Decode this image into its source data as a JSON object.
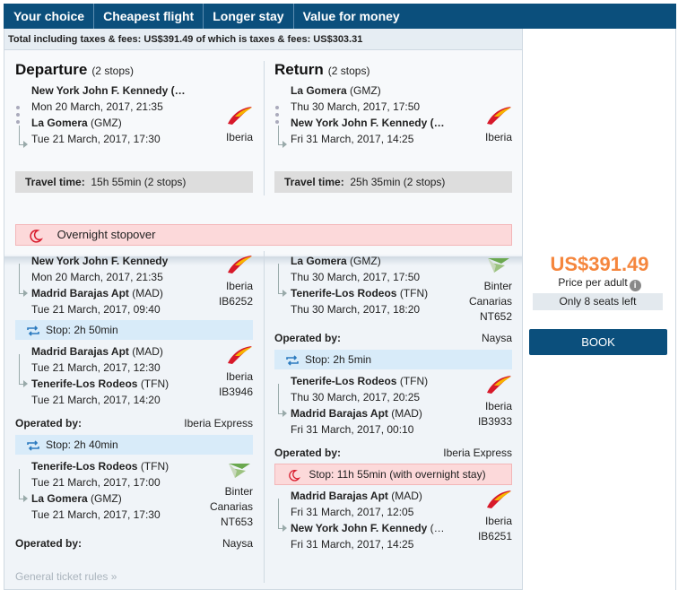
{
  "tabs": [
    "Your choice",
    "Cheapest flight",
    "Longer stay",
    "Value for money"
  ],
  "totals": "Total including taxes & fees: US$391.49 of which is taxes & fees: US$303.31",
  "summary": {
    "departure": {
      "title": "Departure",
      "stops": "(2 stops)",
      "from_city": "New York John F. Kennedy (…",
      "from_dt": "Mon 20 March, 2017, 21:35",
      "to_city": "La Gomera",
      "to_code": "(GMZ)",
      "to_dt": "Tue 21 March, 2017, 17:30",
      "airline": "Iberia",
      "travel_label": "Travel time:",
      "travel_value": "15h 55min (2 stops)"
    },
    "return": {
      "title": "Return",
      "stops": "(2 stops)",
      "from_city": "La Gomera",
      "from_code": "(GMZ)",
      "from_dt": "Thu 30 March, 2017, 17:50",
      "to_city": "New York John F. Kennedy (…",
      "to_dt": "Fri 31 March, 2017, 14:25",
      "airline": "Iberia",
      "travel_label": "Travel time:",
      "travel_value": "25h 35min (2 stops)"
    },
    "overnight": "Overnight stopover"
  },
  "details": {
    "left": {
      "seg1": {
        "from_city": "New York John F. Kennedy",
        "from_dt": "Mon 20 March, 2017, 21:35",
        "to_city": "Madrid Barajas Apt",
        "to_code": "(MAD)",
        "to_dt": "Tue 21 March, 2017, 09:40",
        "airline": "Iberia",
        "flight": "IB6252"
      },
      "stop1": "Stop: 2h 50min",
      "seg2": {
        "from_city": "Madrid Barajas Apt",
        "from_code": "(MAD)",
        "from_dt": "Tue 21 March, 2017, 12:30",
        "to_city": "Tenerife-Los Rodeos",
        "to_code": "(TFN)",
        "to_dt": "Tue 21 March, 2017, 14:20",
        "airline": "Iberia",
        "flight": "IB3946"
      },
      "op2_label": "Operated by:",
      "op2_name": "Iberia Express",
      "stop2": "Stop: 2h 40min",
      "seg3": {
        "from_city": "Tenerife-Los Rodeos",
        "from_code": "(TFN)",
        "from_dt": "Tue 21 March, 2017, 17:00",
        "to_city": "La Gomera",
        "to_code": "(GMZ)",
        "to_dt": "Tue 21 March, 2017, 17:30",
        "airline1": "Binter",
        "airline2": "Canarias",
        "flight": "NT653"
      },
      "op3_label": "Operated by:",
      "op3_name": "Naysa"
    },
    "right": {
      "seg1": {
        "from_city": "La Gomera",
        "from_code": "(GMZ)",
        "from_dt": "Thu 30 March, 2017, 17:50",
        "to_city": "Tenerife-Los Rodeos",
        "to_code": "(TFN)",
        "to_dt": "Thu 30 March, 2017, 18:20",
        "airline1": "Binter",
        "airline2": "Canarias",
        "flight": "NT652"
      },
      "op1_label": "Operated by:",
      "op1_name": "Naysa",
      "stop1": "Stop: 2h 5min",
      "seg2": {
        "from_city": "Tenerife-Los Rodeos",
        "from_code": "(TFN)",
        "from_dt": "Thu 30 March, 2017, 20:25",
        "to_city": "Madrid Barajas Apt",
        "to_code": "(MAD)",
        "to_dt": "Fri 31 March, 2017, 00:10",
        "airline": "Iberia",
        "flight": "IB3933"
      },
      "op2_label": "Operated by:",
      "op2_name": "Iberia Express",
      "stop2": "Stop: 11h 55min",
      "stop2_note": "(with overnight stay)",
      "seg3": {
        "from_city": "Madrid Barajas Apt",
        "from_code": "(MAD)",
        "from_dt": "Fri 31 March, 2017, 12:05",
        "to_city": "New York John F. Kennedy",
        "to_code": "(…",
        "to_dt": "Fri 31 March, 2017, 14:25",
        "airline": "Iberia",
        "flight": "IB6251"
      }
    },
    "rules": "General ticket rules »"
  },
  "pricing": {
    "price": "US$391.49",
    "per_adult": "Price per adult",
    "seats": "Only 8 seats left",
    "book": "BOOK"
  },
  "colors": {
    "header": "#0b4f7c",
    "price": "#f5863d",
    "iberia_red": "#d7192a",
    "iberia_yellow": "#f7b500",
    "binter_green": "#6aa84f"
  }
}
